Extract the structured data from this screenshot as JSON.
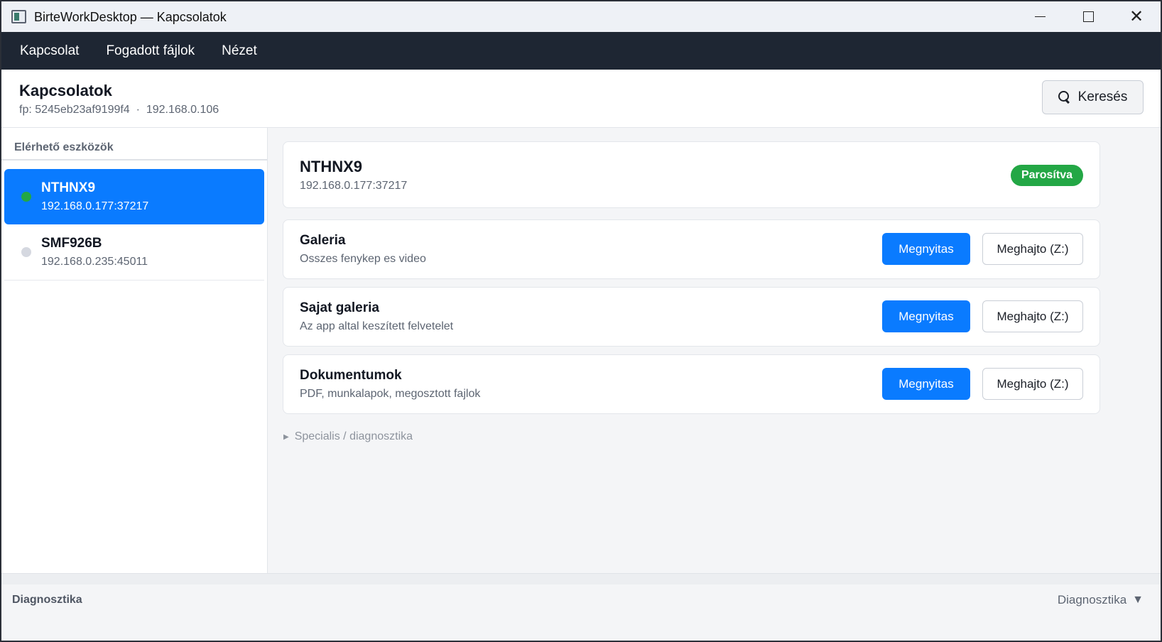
{
  "window": {
    "title": "BirteWorkDesktop — Kapcsolatok",
    "minimize_icon": "minimize-icon",
    "maximize_icon": "maximize-icon",
    "close_icon": "close-icon"
  },
  "menu": {
    "items": [
      "Kapcsolat",
      "Fogadott fájlok",
      "Nézet"
    ]
  },
  "header": {
    "title": "Kapcsolatok",
    "subtitle": "fp: 5245eb23af9199f4  ·  192.168.0.106",
    "search_label": "Keresés"
  },
  "sidebar": {
    "heading": "Elérhető eszközök",
    "devices": [
      {
        "name": "NTHNX9",
        "address": "192.168.0.177:37217",
        "status_color": "#23a745",
        "active": true
      },
      {
        "name": "SMF926B",
        "address": "192.168.0.235:45011",
        "status_color": "#d5d8e0",
        "active": false
      }
    ]
  },
  "main": {
    "device": {
      "name": "NTHNX9",
      "address": "192.168.0.177:37217",
      "badge": "Parosítva",
      "badge_color": "#23a745"
    },
    "folders": [
      {
        "title": "Galeria",
        "subtitle": "Osszes fenykep es video",
        "open_label": "Megnyitas",
        "drive_label": "Meghajto (Z:)"
      },
      {
        "title": "Sajat galeria",
        "subtitle": "Az app altal keszített felvetelet",
        "open_label": "Megnyitas",
        "drive_label": "Meghajto (Z:)"
      },
      {
        "title": "Dokumentumok",
        "subtitle": "PDF, munkalapok, megosztott fajlok",
        "open_label": "Megnyitas",
        "drive_label": "Meghajto (Z:)"
      }
    ],
    "special_toggle": "Specialis / diagnosztika"
  },
  "bottom": {
    "label": "Diagnosztika",
    "toggle_label": "Diagnosztika"
  },
  "colors": {
    "accent": "#0a7bff",
    "menubar": "#1e2633",
    "success": "#23a745"
  }
}
